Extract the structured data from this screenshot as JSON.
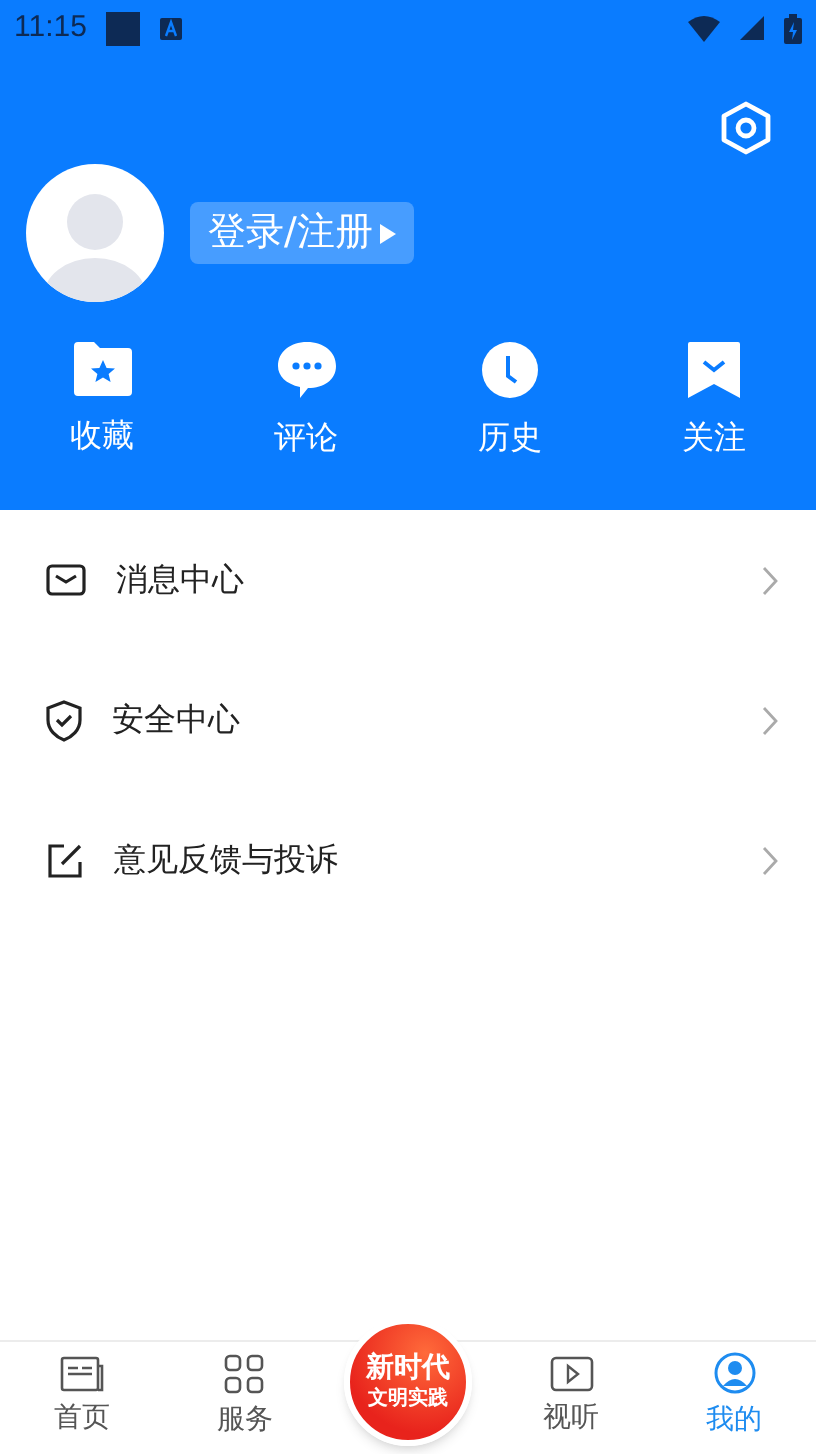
{
  "status_bar": {
    "time": "11:15"
  },
  "profile": {
    "login_label": "登录/注册"
  },
  "shortcuts": [
    {
      "kind": "favorites",
      "label": "收藏"
    },
    {
      "kind": "comments",
      "label": "评论"
    },
    {
      "kind": "history",
      "label": "历史"
    },
    {
      "kind": "follow",
      "label": "关注"
    }
  ],
  "menu": [
    {
      "kind": "message",
      "label": "消息中心"
    },
    {
      "kind": "security",
      "label": "安全中心"
    },
    {
      "kind": "feedback",
      "label": "意见反馈与投诉"
    }
  ],
  "bottom_nav": [
    {
      "kind": "home",
      "label": "首页",
      "selected": false
    },
    {
      "kind": "services",
      "label": "服务",
      "selected": false
    },
    {
      "kind": "center",
      "label_top": "新时代",
      "label_bottom": "文明实践"
    },
    {
      "kind": "media",
      "label": "视听",
      "selected": false
    },
    {
      "kind": "mine",
      "label": "我的",
      "selected": true
    }
  ]
}
